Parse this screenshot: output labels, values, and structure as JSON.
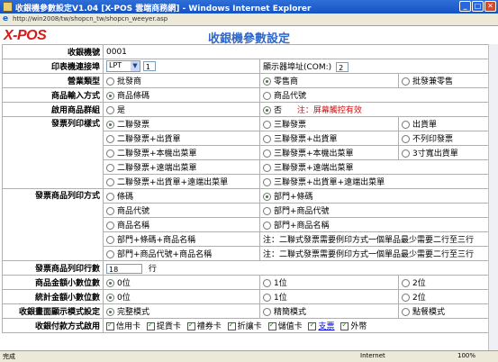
{
  "window": {
    "title": "收銀機參數設定V1.04 [X-POS 雲端商務網] - Windows Internet Explorer"
  },
  "address": {
    "url": "http://win2008/tw/shopcn_tw/shopcn_weeyer.asp"
  },
  "header": {
    "logo": "X-POS",
    "title": "收銀機參數設定"
  },
  "form": {
    "pos_id": {
      "label": "收銀機號",
      "value": "0001"
    },
    "printer": {
      "label": "印表機連接埠",
      "port": "LPT",
      "port_num": "1",
      "display_label": "顯示器埠址(COM:)",
      "display_value": "2"
    },
    "business_type": {
      "label": "營業類型",
      "options": [
        "批發商",
        "零售商",
        "批發兼零售"
      ],
      "selected": 1
    },
    "input_method": {
      "label": "商品輸入方式",
      "options": [
        "商品條碼",
        "商品代號"
      ],
      "selected": 0
    },
    "use_group": {
      "label": "啟用商品群組",
      "options": [
        "是",
        "否"
      ],
      "selected": 1,
      "note": "注：屏幕觸控有效"
    },
    "invoice_style": {
      "label": "發票列印樣式",
      "rows": [
        [
          "二聯發票",
          "三聯發票",
          "出貨單"
        ],
        [
          "二聯發票+出貨單",
          "三聯發票+出貨單",
          "不列印發票"
        ],
        [
          "二聯發票+本機出菜單",
          "三聯發票+本機出菜單",
          "3寸寬出貨單"
        ],
        [
          "二聯發票+遠端出菜單",
          "三聯發票+遠端出菜單",
          ""
        ],
        [
          "二聯發票+出貨單+遠端出菜單",
          "三聯發票+出貨單+遠端出菜單",
          ""
        ]
      ],
      "selected": "二聯發票"
    },
    "item_print": {
      "label": "發票商品列印方式",
      "rows": [
        [
          "條碼",
          "部門+條碼"
        ],
        [
          "商品代號",
          "部門+商品代號"
        ],
        [
          "商品名稱",
          "部門+商品名稱"
        ],
        [
          "部門+條碼+商品名稱",
          "注：二聯式發票需要例印方式一個單品最少需要二行至三行"
        ],
        [
          "部門+商品代號+商品名稱",
          "注：二聯式發票需要例印方式一個單品最少需要二行至三行"
        ]
      ],
      "selected": "部門+條碼"
    },
    "item_lines": {
      "label": "發票商品列印行數",
      "value": "18",
      "unit": "行"
    },
    "amount_decimals": {
      "label": "商品金額小數位數",
      "options": [
        "0位",
        "1位",
        "2位"
      ],
      "selected": 0
    },
    "total_decimals": {
      "label": "統計金額小數位數",
      "options": [
        "0位",
        "1位",
        "2位"
      ],
      "selected": 0
    },
    "display_mode": {
      "label": "收銀畫面顯示模式設定",
      "options": [
        "完整模式",
        "精簡模式",
        "點餐模式"
      ],
      "selected": 0
    },
    "payment": {
      "label": "收銀付款方式啟用",
      "items": [
        {
          "text": "信用卡",
          "checked": true
        },
        {
          "text": "提貨卡",
          "checked": true
        },
        {
          "text": "禮券卡",
          "checked": true
        },
        {
          "text": "折讓卡",
          "checked": true
        },
        {
          "text": "儲值卡",
          "checked": true
        },
        {
          "text": "支票",
          "checked": true
        },
        {
          "text": "外幣",
          "checked": true
        }
      ]
    }
  },
  "status": {
    "text": "完成",
    "zone": "Internet",
    "zoom": "100%"
  }
}
